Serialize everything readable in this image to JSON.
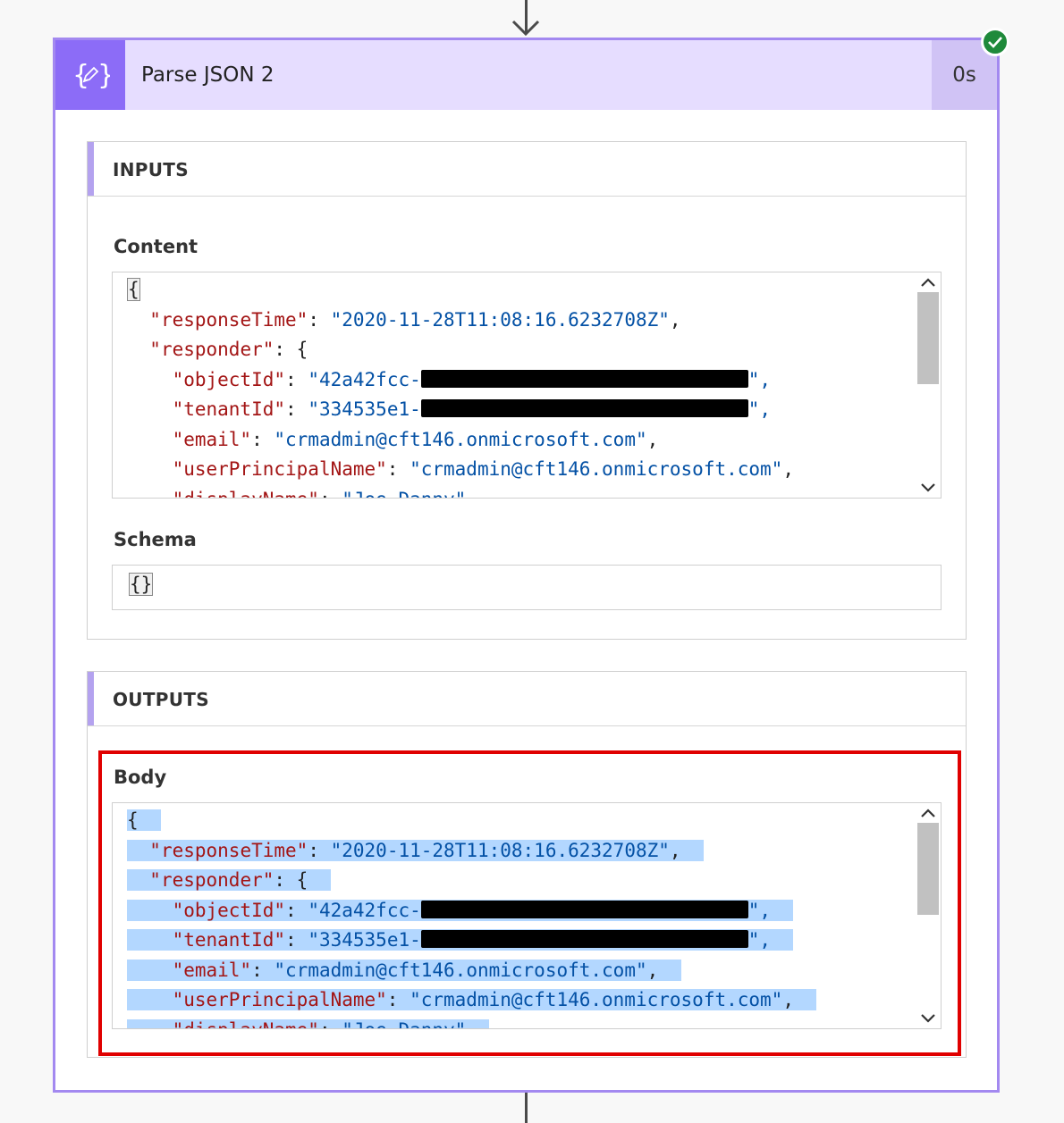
{
  "action": {
    "title": "Parse JSON 2",
    "duration": "0s",
    "status_icon": "check-icon",
    "icon": "json-edit-icon",
    "accent_color": "#8c6cf7"
  },
  "inputs": {
    "section_title": "INPUTS",
    "content_label": "Content",
    "schema_label": "Schema",
    "schema_value": "{}",
    "content_lines": [
      {
        "indent": "",
        "text": "{"
      },
      {
        "indent": "  ",
        "key": "\"responseTime\"",
        "sep": ": ",
        "value": "\"2020-11-28T11:08:16.6232708Z\"",
        "end": ","
      },
      {
        "indent": "  ",
        "key": "\"responder\"",
        "sep": ": ",
        "value": "",
        "end": "{"
      },
      {
        "indent": "    ",
        "key": "\"objectId\"",
        "sep": ": ",
        "value": "\"42a42fcc-",
        "redacted": true,
        "end": "\","
      },
      {
        "indent": "    ",
        "key": "\"tenantId\"",
        "sep": ": ",
        "value": "\"334535e1-",
        "redacted": true,
        "end": "\","
      },
      {
        "indent": "    ",
        "key": "\"email\"",
        "sep": ": ",
        "value": "\"crmadmin@cft146.onmicrosoft.com\"",
        "end": ","
      },
      {
        "indent": "    ",
        "key": "\"userPrincipalName\"",
        "sep": ": ",
        "value": "\"crmadmin@cft146.onmicrosoft.com\"",
        "end": ","
      },
      {
        "indent": "    ",
        "key": "\"displayName\"",
        "sep": ": ",
        "value": "\"Joe Danny\"",
        "end": ""
      }
    ]
  },
  "outputs": {
    "section_title": "OUTPUTS",
    "body_label": "Body",
    "body_lines": [
      {
        "indent": "",
        "text": "{"
      },
      {
        "indent": "  ",
        "key": "\"responseTime\"",
        "sep": ": ",
        "value": "\"2020-11-28T11:08:16.6232708Z\"",
        "end": ","
      },
      {
        "indent": "  ",
        "key": "\"responder\"",
        "sep": ": ",
        "value": "",
        "end": "{"
      },
      {
        "indent": "    ",
        "key": "\"objectId\"",
        "sep": ": ",
        "value": "\"42a42fcc-",
        "redacted": true,
        "end": "\","
      },
      {
        "indent": "    ",
        "key": "\"tenantId\"",
        "sep": ": ",
        "value": "\"334535e1-",
        "redacted": true,
        "end": "\","
      },
      {
        "indent": "    ",
        "key": "\"email\"",
        "sep": ": ",
        "value": "\"crmadmin@cft146.onmicrosoft.com\"",
        "end": ","
      },
      {
        "indent": "    ",
        "key": "\"userPrincipalName\"",
        "sep": ": ",
        "value": "\"crmadmin@cft146.onmicrosoft.com\"",
        "end": ","
      },
      {
        "indent": "    ",
        "key": "\"displayName\"",
        "sep": ": ",
        "value": "\"Joe Danny\"",
        "end": ""
      }
    ]
  }
}
